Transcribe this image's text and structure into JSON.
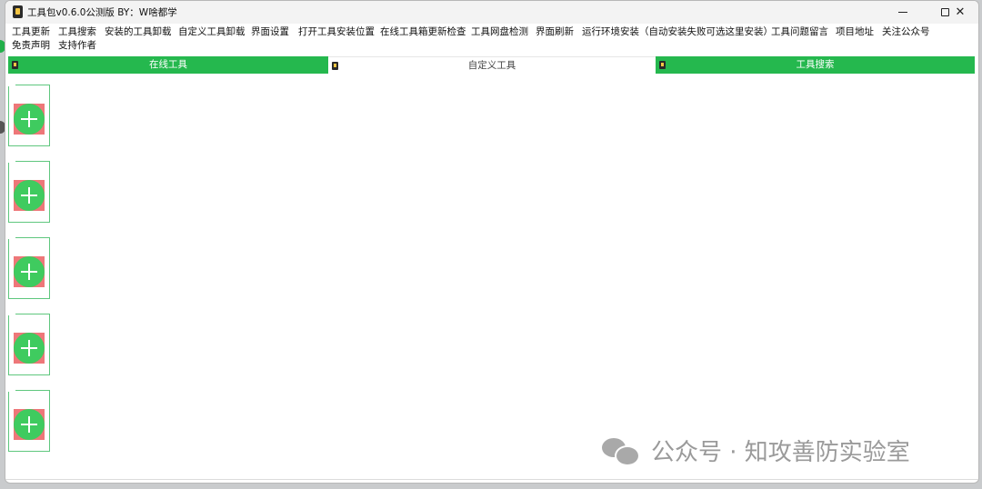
{
  "window": {
    "title": "工具包v0.6.0公测版  BY：W啥都学"
  },
  "menu": [
    {
      "label": "工具更新"
    },
    {
      "label": "工具搜索"
    },
    {
      "label": "安装的工具卸载"
    },
    {
      "label": "自定义工具卸载"
    },
    {
      "label": "界面设置"
    },
    {
      "label": "打开工具安装位置"
    },
    {
      "label": "在线工具箱更新检查"
    },
    {
      "label": "工具网盘检测"
    },
    {
      "label": "界面刷新"
    },
    {
      "label": "运行环境安装（自动安装失败可选这里安装）"
    },
    {
      "label": "工具问题留言"
    },
    {
      "label": "项目地址"
    },
    {
      "label": "关注公众号"
    },
    {
      "label": "免责声明"
    },
    {
      "label": "支持作者"
    }
  ],
  "tabs": [
    {
      "label": "在线工具",
      "style": "green"
    },
    {
      "label": "自定义工具",
      "style": "white"
    },
    {
      "label": "工具搜索",
      "style": "green"
    }
  ],
  "cards_count": 5,
  "watermark": {
    "text": "公众号 · 知攻善防实验室",
    "icon": "wechat-icon"
  },
  "colors": {
    "accent_green": "#25b84e",
    "add_circle": "#3fcb5f",
    "add_background": "#ee7779",
    "card_border": "#5fc77e"
  }
}
